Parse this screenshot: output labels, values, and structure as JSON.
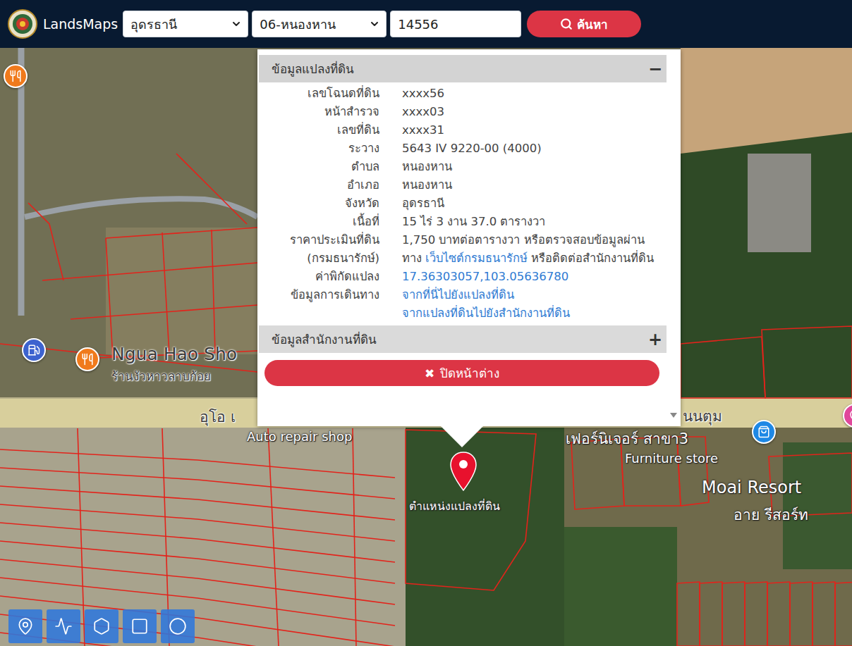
{
  "navbar": {
    "brand": "LandsMaps",
    "province": "อุดรธานี",
    "district": "06-หนองหาน",
    "search_value": "14556",
    "search_button": "ค้นหา"
  },
  "popup": {
    "title": "ข้อมูลแปลงที่ดิน",
    "title_toggle": "−",
    "expanded": true,
    "rows": [
      {
        "label": [
          "เลขโฉนดที่ดิน"
        ],
        "value": [
          [
            {
              "text": "xxxx56",
              "link": false
            }
          ]
        ]
      },
      {
        "label": [
          "หน้าสำรวจ"
        ],
        "value": [
          [
            {
              "text": "xxxx03",
              "link": false
            }
          ]
        ]
      },
      {
        "label": [
          "เลขที่ดิน"
        ],
        "value": [
          [
            {
              "text": "xxxx31",
              "link": false
            }
          ]
        ]
      },
      {
        "label": [
          "ระวาง"
        ],
        "value": [
          [
            {
              "text": "5643 IV 9220-00 (4000)",
              "link": false
            }
          ]
        ]
      },
      {
        "label": [
          "ตำบล"
        ],
        "value": [
          [
            {
              "text": "หนองหาน",
              "link": false
            }
          ]
        ]
      },
      {
        "label": [
          "อำเภอ"
        ],
        "value": [
          [
            {
              "text": "หนองหาน",
              "link": false
            }
          ]
        ]
      },
      {
        "label": [
          "จังหวัด"
        ],
        "value": [
          [
            {
              "text": "อุดรธานี",
              "link": false
            }
          ]
        ]
      },
      {
        "label": [
          "เนื้อที่"
        ],
        "value": [
          [
            {
              "text": "15 ไร่ 3 งาน 37.0 ตารางวา",
              "link": false
            }
          ]
        ]
      },
      {
        "label": [
          "ราคาประเมินที่ดิน",
          "(กรมธนารักษ์)"
        ],
        "value": [
          [
            {
              "text": "1,750 บาทต่อตารางวา หรือตรวจสอบข้อมูลผ่าน",
              "link": false
            }
          ],
          [
            {
              "text": "ทาง ",
              "link": false
            },
            {
              "text": "เว็บไซต์กรมธนารักษ์",
              "link": true
            },
            {
              "text": " หรือติดต่อสำนักงานที่ดิน",
              "link": false
            }
          ]
        ]
      },
      {
        "label": [
          "ค่าพิกัดแปลง"
        ],
        "value": [
          [
            {
              "text": "17.36303057,103.05636780",
              "link": true
            }
          ]
        ]
      },
      {
        "label": [
          "ข้อมูลการเดินทาง"
        ],
        "value": [
          [
            {
              "text": "จากที่นี่ไปยังแปลงที่ดิน",
              "link": true
            }
          ],
          [
            {
              "text": "จากแปลงที่ดินไปยังสำนักงานที่ดิน",
              "link": true
            }
          ]
        ]
      }
    ],
    "office": {
      "title": "ข้อมูลสำนักงานที่ดิน",
      "toggle": "+",
      "expanded": false
    },
    "close_button": {
      "icon": "✖",
      "label": "ปิดหน้าต่าง"
    }
  },
  "map": {
    "marker_label": "ตำแหน่งแปลงที่ดิน",
    "pois": [
      {
        "kind": "restaurant"
      },
      {
        "kind": "restaurant"
      },
      {
        "kind": "gas"
      },
      {
        "kind": "shop"
      },
      {
        "kind": "poi"
      }
    ],
    "labels": [
      {
        "text": "Ngua Hao Sho",
        "kind": "dark"
      },
      {
        "text": "ร้านงัวหาวลาบก้อย",
        "kind": "dark"
      },
      {
        "text": "อุโอ เ",
        "kind": "road"
      },
      {
        "text": "Auto repair shop",
        "kind": "light"
      },
      {
        "text": "นนตุม",
        "kind": "road"
      },
      {
        "text": "เฟอร์นิเจอร์ สาขา3",
        "kind": "light"
      },
      {
        "text": "Furniture store",
        "kind": "light"
      },
      {
        "text": "Moai Resort",
        "kind": "light"
      },
      {
        "text": "อาย รีสอร์ท",
        "kind": "light"
      }
    ]
  },
  "tools": [
    {
      "kind": "point"
    },
    {
      "kind": "line"
    },
    {
      "kind": "polygon"
    },
    {
      "kind": "rectangle"
    },
    {
      "kind": "circle"
    }
  ]
}
